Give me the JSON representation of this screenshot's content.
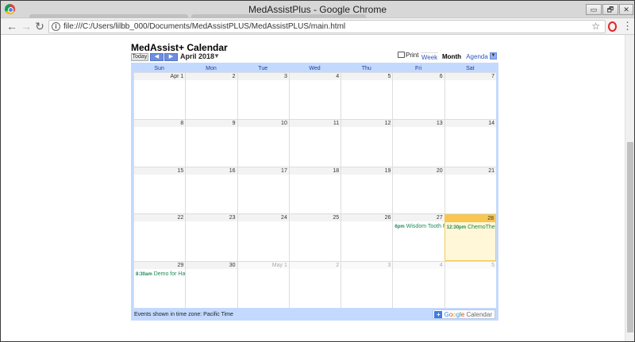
{
  "browser": {
    "window_title": "MedAssistPlus - Google Chrome",
    "url": "file:///C:/Users/lilbb_000/Documents/MedAssistPLUS/MedAssistPLUS/main.html",
    "controls": {
      "minimize": "▭",
      "maximize": "🗗",
      "close": "✕"
    }
  },
  "calendar": {
    "title": "MedAssist+ Calendar",
    "today_label": "Today",
    "prev_label": "◀",
    "next_label": "▶",
    "month_label": "April 2018",
    "print_label": "Print",
    "views": {
      "week": "Week",
      "month": "Month",
      "agenda": "Agenda"
    },
    "active_view": "Month",
    "day_headers": [
      "Sun",
      "Mon",
      "Tue",
      "Wed",
      "Thu",
      "Fri",
      "Sat"
    ],
    "weeks": [
      [
        {
          "d": "Apr 1"
        },
        {
          "d": "2"
        },
        {
          "d": "3"
        },
        {
          "d": "4"
        },
        {
          "d": "5"
        },
        {
          "d": "6"
        },
        {
          "d": "7"
        }
      ],
      [
        {
          "d": "8"
        },
        {
          "d": "9"
        },
        {
          "d": "10"
        },
        {
          "d": "11"
        },
        {
          "d": "12"
        },
        {
          "d": "13"
        },
        {
          "d": "14"
        }
      ],
      [
        {
          "d": "15"
        },
        {
          "d": "16"
        },
        {
          "d": "17"
        },
        {
          "d": "18"
        },
        {
          "d": "19"
        },
        {
          "d": "20"
        },
        {
          "d": "21"
        }
      ],
      [
        {
          "d": "22"
        },
        {
          "d": "23"
        },
        {
          "d": "24"
        },
        {
          "d": "25"
        },
        {
          "d": "26"
        },
        {
          "d": "27",
          "event": {
            "time": "6pm",
            "title": "Wisdom Tooth R"
          }
        },
        {
          "d": "28",
          "today": true,
          "event": {
            "time": "12:30pm",
            "title": "ChemoTher"
          }
        }
      ],
      [
        {
          "d": "29",
          "event": {
            "time": "8:30am",
            "title": "Demo for Ha"
          }
        },
        {
          "d": "30"
        },
        {
          "d": "May 1",
          "other": true
        },
        {
          "d": "2",
          "other": true
        },
        {
          "d": "3",
          "other": true
        },
        {
          "d": "4",
          "other": true
        },
        {
          "d": "5",
          "other": true
        }
      ]
    ],
    "timezone_note": "Events shown in time zone: Pacific Time",
    "badge": {
      "plus": "+",
      "g": "G",
      "o1": "o",
      "o2": "o",
      "g2": "g",
      "l": "l",
      "e": "e",
      "suffix": "Calendar"
    },
    "colors": {
      "event_text": "#1e8a5a",
      "today_bg": "#fff7d7",
      "today_header": "#f9c651",
      "frame": "#c3d9ff"
    }
  }
}
